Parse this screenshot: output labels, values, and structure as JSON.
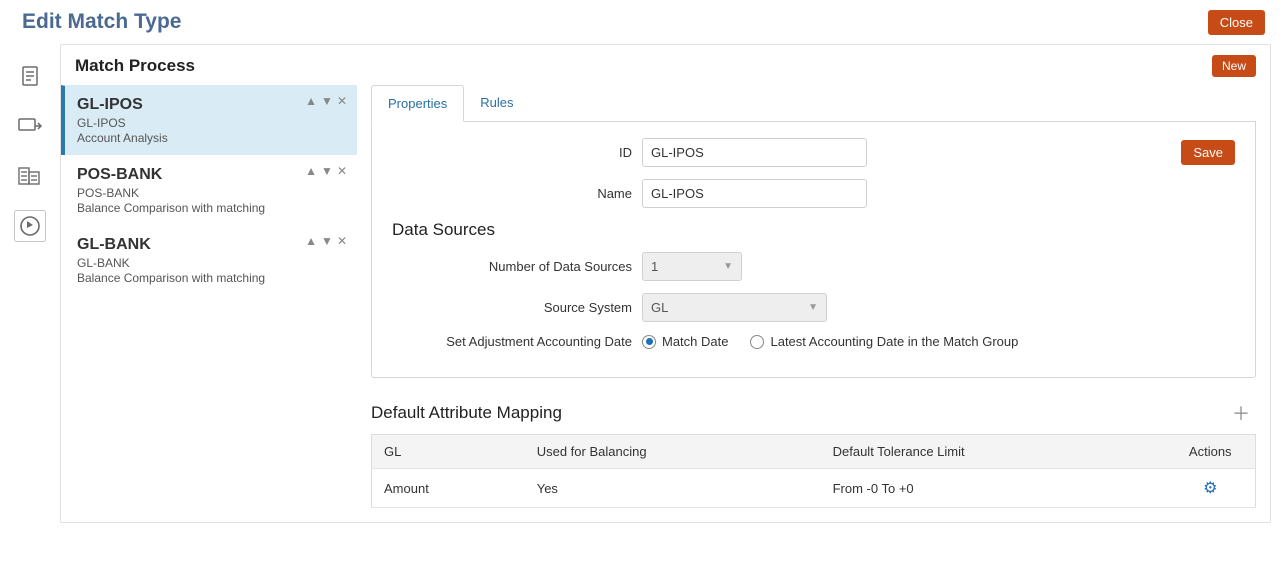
{
  "header": {
    "title": "Edit Match Type",
    "close": "Close"
  },
  "section": {
    "title": "Match Process",
    "new": "New"
  },
  "processes": [
    {
      "name": "GL-IPOS",
      "id": "GL-IPOS",
      "desc": "Account Analysis"
    },
    {
      "name": "POS-BANK",
      "id": "POS-BANK",
      "desc": "Balance Comparison with matching"
    },
    {
      "name": "GL-BANK",
      "id": "GL-BANK",
      "desc": "Balance Comparison with matching"
    }
  ],
  "tabs": {
    "properties": "Properties",
    "rules": "Rules"
  },
  "form": {
    "id_label": "ID",
    "id_value": "GL-IPOS",
    "name_label": "Name",
    "name_value": "GL-IPOS",
    "save": "Save",
    "ds_title": "Data Sources",
    "num_label": "Number of Data Sources",
    "num_value": "1",
    "src_label": "Source System",
    "src_value": "GL",
    "adj_label": "Set Adjustment Accounting Date",
    "radio1": "Match Date",
    "radio2": "Latest Accounting Date in the Match Group"
  },
  "mapping": {
    "title": "Default Attribute Mapping",
    "cols": {
      "c1": "GL",
      "c2": "Used for Balancing",
      "c3": "Default Tolerance Limit",
      "c4": "Actions"
    },
    "row": {
      "c1": "Amount",
      "c2": "Yes",
      "c3": "From -0 To +0"
    }
  }
}
